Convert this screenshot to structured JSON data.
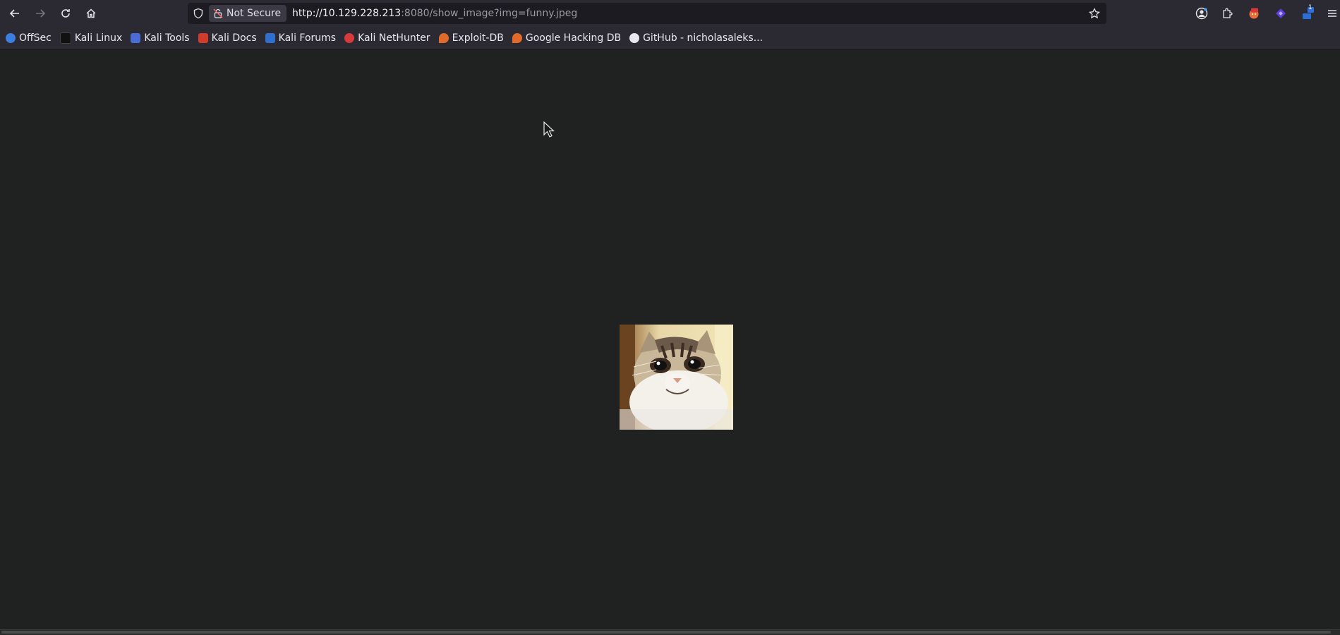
{
  "browser": {
    "security_label": "Not Secure",
    "url_host": "http://10.129.228.213",
    "url_rest": ":8080/show_image?img=funny.jpeg",
    "badge_count": "1"
  },
  "bookmarks": [
    {
      "label": "OffSec",
      "icon": "offsec-icon",
      "color": "#3b7de0"
    },
    {
      "label": "Kali Linux",
      "icon": "kali-dragon-icon",
      "color": "#111111"
    },
    {
      "label": "Kali Tools",
      "icon": "kali-tools-icon",
      "color": "#4a6cd8"
    },
    {
      "label": "Kali Docs",
      "icon": "kali-docs-icon",
      "color": "#d23a2a"
    },
    {
      "label": "Kali Forums",
      "icon": "kali-forums-icon",
      "color": "#2f6fd0"
    },
    {
      "label": "Kali NetHunter",
      "icon": "nethunter-icon",
      "color": "#d63a3a"
    },
    {
      "label": "Exploit-DB",
      "icon": "exploitdb-icon",
      "color": "#e06a2a"
    },
    {
      "label": "Google Hacking DB",
      "icon": "ghdb-icon",
      "color": "#e06a2a"
    },
    {
      "label": "GitHub - nicholasaleks...",
      "icon": "github-icon",
      "color": "#e8e8ee"
    }
  ]
}
